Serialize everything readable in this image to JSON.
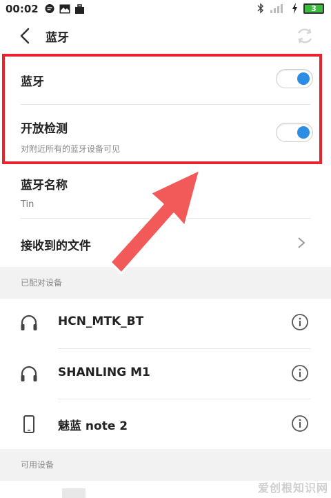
{
  "status_bar": {
    "time": "00:02",
    "battery_level": "3",
    "icons": [
      "chat-bubble-icon",
      "mail-icon",
      "briefcase-icon",
      "bluetooth-icon",
      "signal-icon",
      "charging-bolt-icon",
      "battery-icon"
    ]
  },
  "header": {
    "title": "蓝牙",
    "back_icon": "back-arrow-icon",
    "refresh_icon": "refresh-icon"
  },
  "settings": {
    "bluetooth": {
      "label": "蓝牙",
      "enabled": true
    },
    "discoverable": {
      "label": "开放检测",
      "sublabel": "对附近所有的蓝牙设备可见",
      "enabled": true
    },
    "device_name": {
      "label": "蓝牙名称",
      "value": "Tin"
    },
    "received_files": {
      "label": "接收到的文件"
    }
  },
  "paired_section": {
    "title": "已配对设备",
    "devices": [
      {
        "name": "HCN_MTK_BT",
        "icon": "headphones-icon"
      },
      {
        "name": "SHANLING M1",
        "icon": "headphones-icon"
      },
      {
        "name": "魅蓝 note 2",
        "icon": "phone-icon"
      }
    ]
  },
  "available_section": {
    "title": "可用设备"
  },
  "watermark": "爱创根知识网",
  "colors": {
    "accent": "#2b8de3",
    "annotation_red": "#e8232e",
    "battery_green": "#3cbc3c"
  }
}
